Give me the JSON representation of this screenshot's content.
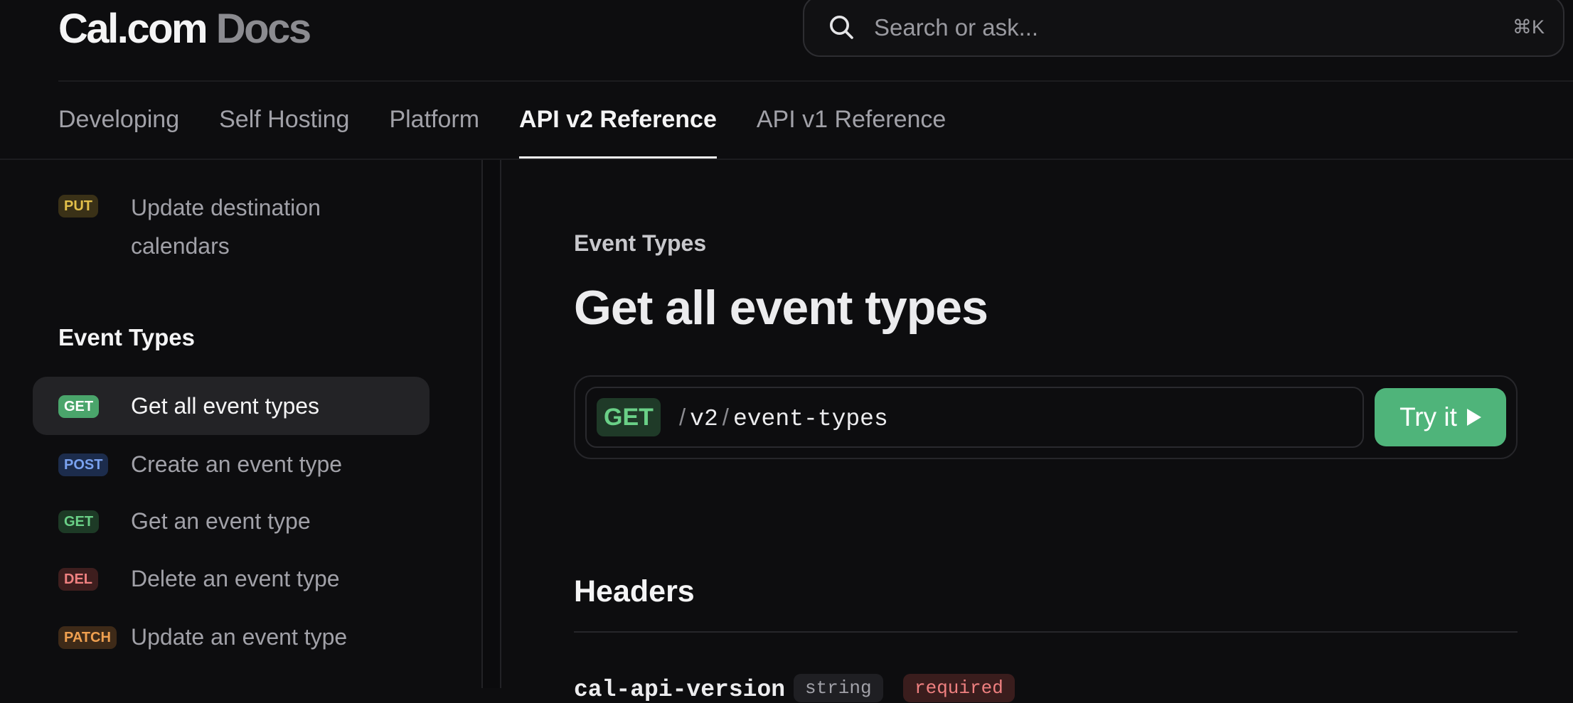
{
  "header": {
    "logo_brand": "Cal.com",
    "logo_docs": "Docs",
    "search_placeholder": "Search or ask...",
    "search_shortcut": "⌘K"
  },
  "tabs": [
    {
      "label": "Developing",
      "active": false
    },
    {
      "label": "Self Hosting",
      "active": false
    },
    {
      "label": "Platform",
      "active": false
    },
    {
      "label": "API v2 Reference",
      "active": true
    },
    {
      "label": "API v1 Reference",
      "active": false
    }
  ],
  "sidebar": {
    "prev_item": {
      "method": "PUT",
      "label_line1": "Update destination",
      "label_line2": "calendars"
    },
    "group_title": "Event Types",
    "items": [
      {
        "method": "GET",
        "label": "Get all event types",
        "active": true
      },
      {
        "method": "POST",
        "label": "Create an event type",
        "active": false
      },
      {
        "method": "GET",
        "label": "Get an event type",
        "active": false
      },
      {
        "method": "DEL",
        "label": "Delete an event type",
        "active": false
      },
      {
        "method": "PATCH",
        "label": "Update an event type",
        "active": false
      }
    ]
  },
  "main": {
    "breadcrumb": "Event Types",
    "title": "Get all event types",
    "endpoint": {
      "method": "GET",
      "path_segment1": "v2",
      "path_segment2": "event-types",
      "separator": "/",
      "try_label": "Try it"
    },
    "headers_title": "Headers",
    "param": {
      "name": "cal-api-version",
      "type": "string",
      "required": "required"
    }
  },
  "colors": {
    "background": "#0d0d0f",
    "accent_green": "#4fb47a",
    "text_primary": "#f4f4f5",
    "text_muted": "#a1a1a8"
  }
}
